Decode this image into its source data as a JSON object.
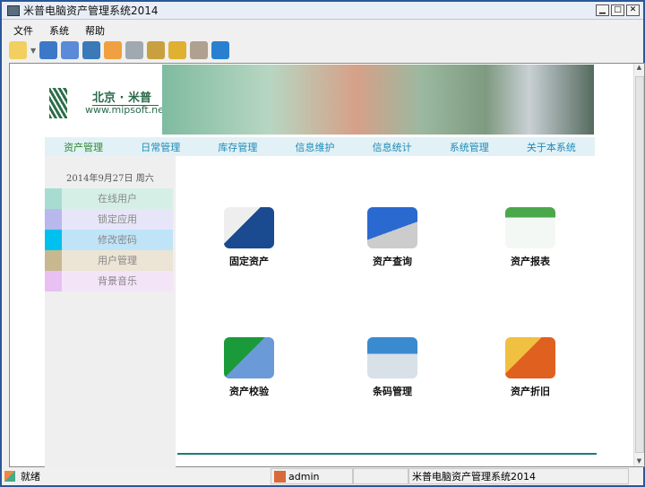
{
  "window": {
    "title": "米普电脑资产管理系统2014"
  },
  "menu": [
    "文件",
    "系统",
    "帮助"
  ],
  "toolbar": [
    "open-folder-icon",
    "list-icon",
    "monitor-check-icon",
    "spreadsheet-icon",
    "home-icon",
    "printer-icon",
    "keys-users-icon",
    "lock-arrow-icon",
    "lock-user-icon",
    "exit-door-icon"
  ],
  "banner": {
    "brand": "北京 · 米普",
    "url": "www.mipsoft.net"
  },
  "nav": [
    "资产管理",
    "日常管理",
    "库存管理",
    "信息维护",
    "信息统计",
    "系统管理",
    "关于本系统"
  ],
  "side": {
    "date": "2014年9月27日  周六",
    "items": [
      {
        "label": "在线用户",
        "color": "#a7ddd0",
        "bg": "#d5efe6"
      },
      {
        "label": "锁定应用",
        "color": "#b8b8ee",
        "bg": "#e6e6f8"
      },
      {
        "label": "修改密码",
        "color": "#00c0f0",
        "bg": "#bfe4f8"
      },
      {
        "label": "用户管理",
        "color": "#c8b890",
        "bg": "#ece4d4"
      },
      {
        "label": "背景音乐",
        "color": "#e8c0f4",
        "bg": "#f4e4f8"
      }
    ]
  },
  "apps": [
    {
      "label": "固定资产",
      "icon": "desktop-computer-icon"
    },
    {
      "label": "资产查询",
      "icon": "laptop-icon"
    },
    {
      "label": "资产报表",
      "icon": "spreadsheet-report-icon"
    },
    {
      "label": "资产校验",
      "icon": "checkmark-window-icon"
    },
    {
      "label": "条码管理",
      "icon": "barcode-printer-icon"
    },
    {
      "label": "资产折旧",
      "icon": "magnifier-document-icon"
    }
  ],
  "status": {
    "ready": "就绪",
    "user": "admin",
    "app": "米普电脑资产管理系统2014"
  }
}
